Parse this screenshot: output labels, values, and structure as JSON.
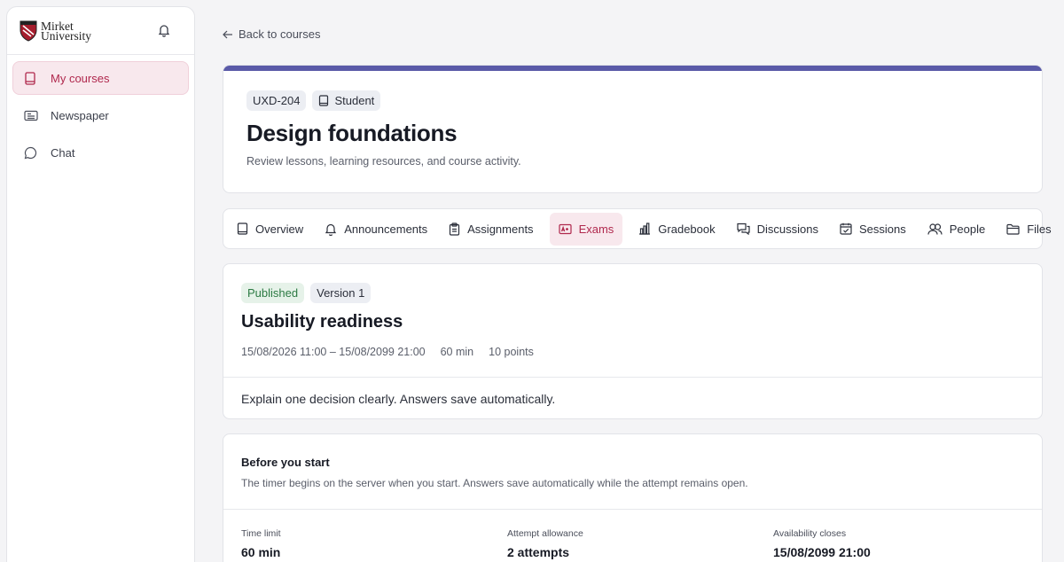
{
  "brand": {
    "line1": "Mirket",
    "line2": "University"
  },
  "sidebar": {
    "items": [
      {
        "label": "My courses",
        "icon": "book-icon",
        "active": true
      },
      {
        "label": "Newspaper",
        "icon": "newspaper-icon"
      },
      {
        "label": "Chat",
        "icon": "chat-bubble-icon"
      }
    ]
  },
  "back_link": "Back to courses",
  "course": {
    "code": "UXD-204",
    "role": "Student",
    "title": "Design foundations",
    "subtitle": "Review lessons, learning resources, and course activity."
  },
  "tabs": [
    {
      "label": "Overview",
      "icon": "book-icon"
    },
    {
      "label": "Announcements",
      "icon": "bell-icon"
    },
    {
      "label": "Assignments",
      "icon": "clipboard-icon"
    },
    {
      "label": "Exams",
      "icon": "grade-card-icon",
      "active": true
    },
    {
      "label": "Gradebook",
      "icon": "bar-chart-icon"
    },
    {
      "label": "Discussions",
      "icon": "discussion-icon"
    },
    {
      "label": "Sessions",
      "icon": "calendar-check-icon"
    },
    {
      "label": "People",
      "icon": "people-icon"
    },
    {
      "label": "Files",
      "icon": "folder-icon"
    }
  ],
  "exam": {
    "status": "Published",
    "version": "Version 1",
    "title": "Usability readiness",
    "window": "15/08/2026 11:00 – 15/08/2099 21:00",
    "duration": "60 min",
    "points": "10 points",
    "description": "Explain one decision clearly. Answers save automatically."
  },
  "before": {
    "heading": "Before you start",
    "note": "The timer begins on the server when you start. Answers save automatically while the attempt remains open.",
    "stats": [
      {
        "label": "Time limit",
        "value": "60 min"
      },
      {
        "label": "Attempt allowance",
        "value": "2 attempts"
      },
      {
        "label": "Availability closes",
        "value": "15/08/2099 21:00"
      }
    ]
  },
  "colors": {
    "accent": "#b0284d",
    "accent_bg": "#f8e8ed",
    "course_bar": "#5a5aa8",
    "published": "#2c7a43"
  }
}
